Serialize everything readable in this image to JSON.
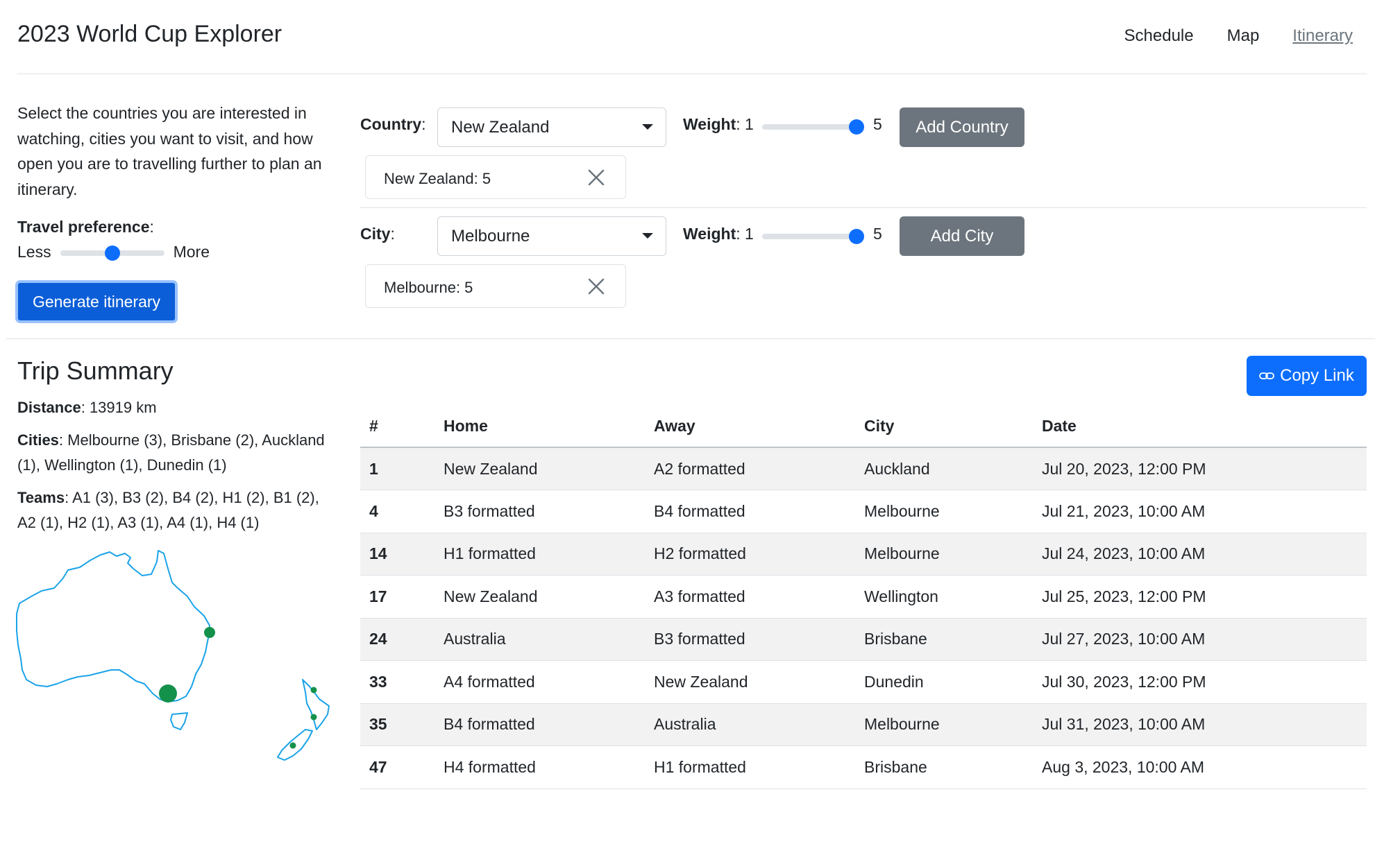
{
  "app": {
    "title": "2023 World Cup Explorer"
  },
  "nav": {
    "schedule": "Schedule",
    "map": "Map",
    "itinerary": "Itinerary"
  },
  "intro": {
    "text": "Select the countries you are interested in watching, cities you want to visit, and how open you are to travelling further to plan an itinerary.",
    "travel_label": "Travel preference",
    "travel_suffix": ":",
    "less": "Less",
    "more": "More",
    "travel_value": 0.5,
    "generate_label": "Generate itinerary"
  },
  "country": {
    "label": "Country",
    "colon": ":",
    "selected": "New Zealand",
    "weight_label": "Weight",
    "weight_colon": ":",
    "weight_min": "1",
    "weight_max": "5",
    "weight_value": 5,
    "add_label": "Add Country",
    "chip": "New Zealand: 5"
  },
  "city": {
    "label": "City",
    "colon": ":",
    "selected": "Melbourne",
    "weight_label": "Weight",
    "weight_colon": ":",
    "weight_min": "1",
    "weight_max": "5",
    "weight_value": 5,
    "add_label": "Add City",
    "chip": "Melbourne: 5"
  },
  "summary": {
    "title": "Trip Summary",
    "distance_label": "Distance",
    "distance_value": ": 13919 km",
    "cities_label": "Cities",
    "cities_value": ": Melbourne (3), Brisbane (2), Auckland (1), Wellington (1), Dunedin (1)",
    "teams_label": "Teams",
    "teams_value": ": A1 (3), B3 (2), B4 (2), H1 (2), B1 (2), A2 (1), H2 (1), A3 (1), A4 (1), H4 (1)",
    "copy_label": "Copy Link"
  },
  "table": {
    "headers": [
      "#",
      "Home",
      "Away",
      "City",
      "Date"
    ],
    "rows": [
      [
        "1",
        "New Zealand",
        "A2 formatted",
        "Auckland",
        "Jul 20, 2023, 12:00 PM"
      ],
      [
        "4",
        "B3 formatted",
        "B4 formatted",
        "Melbourne",
        "Jul 21, 2023, 10:00 AM"
      ],
      [
        "14",
        "H1 formatted",
        "H2 formatted",
        "Melbourne",
        "Jul 24, 2023, 10:00 AM"
      ],
      [
        "17",
        "New Zealand",
        "A3 formatted",
        "Wellington",
        "Jul 25, 2023, 12:00 PM"
      ],
      [
        "24",
        "Australia",
        "B3 formatted",
        "Brisbane",
        "Jul 27, 2023, 10:00 AM"
      ],
      [
        "33",
        "A4 formatted",
        "New Zealand",
        "Dunedin",
        "Jul 30, 2023, 12:00 PM"
      ],
      [
        "35",
        "B4 formatted",
        "Australia",
        "Melbourne",
        "Jul 31, 2023, 10:00 AM"
      ],
      [
        "47",
        "H4 formatted",
        "H1 formatted",
        "Brisbane",
        "Aug 3, 2023, 10:00 AM"
      ]
    ]
  },
  "colors": {
    "primary": "#0d6efd",
    "secondary": "#6c757d",
    "map_outline": "#1aa3e8",
    "map_marker": "#14914a"
  },
  "icons": {
    "close": "close-icon",
    "link": "link-icon",
    "caret": "chevron-down-icon"
  }
}
